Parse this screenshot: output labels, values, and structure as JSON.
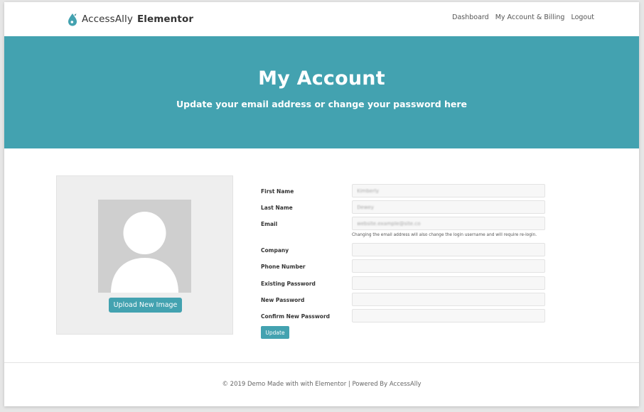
{
  "header": {
    "brand_regular": "AccessAlly",
    "brand_bold": "Elementor",
    "nav": [
      "Dashboard",
      "My Account & Billing",
      "Logout"
    ]
  },
  "hero": {
    "title": "My Account",
    "subtitle": "Update your email address or change your password here"
  },
  "profile": {
    "upload_label": "Upload New Image"
  },
  "form": {
    "first_name_label": "First Name",
    "first_name_value": "Kimberly",
    "last_name_label": "Last Name",
    "last_name_value": "Dewey",
    "email_label": "Email",
    "email_value": "website.example@site.co",
    "email_hint": "Changing the email address will also change the login username and will require re-login.",
    "company_label": "Company",
    "company_value": "",
    "phone_label": "Phone Number",
    "phone_value": "",
    "existing_password_label": "Existing Password",
    "new_password_label": "New Password",
    "confirm_password_label": "Confirm New Password",
    "update_label": "Update"
  },
  "footer": {
    "text": "© 2019 Demo Made with with Elementor | Powered By AccessAlly"
  },
  "colors": {
    "accent": "#43a2b0",
    "avatar_bg": "#cfcfcf",
    "panel_bg": "#eeeeee"
  }
}
